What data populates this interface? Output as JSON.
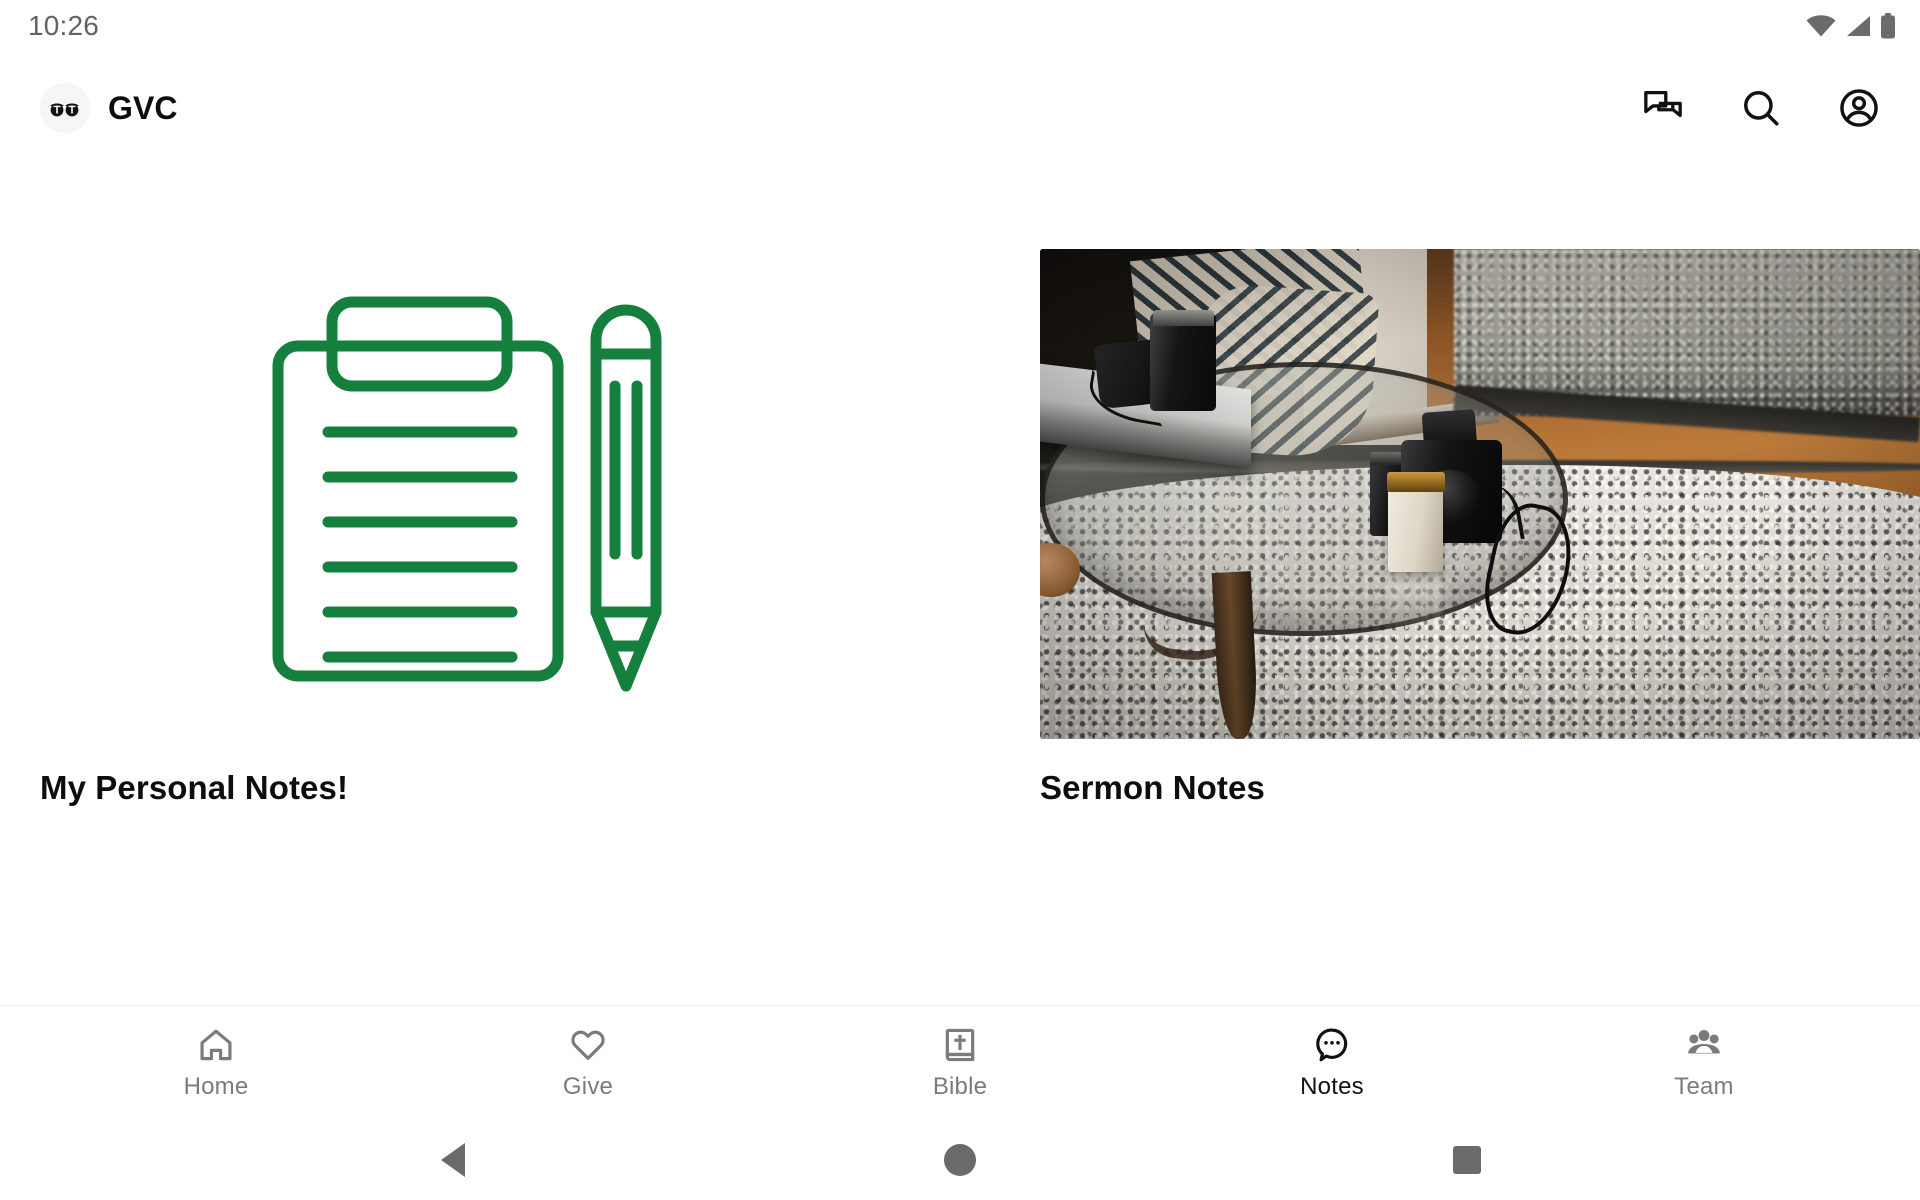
{
  "status_bar": {
    "time": "10:26",
    "icons": [
      "wifi-icon",
      "cellular-signal-icon",
      "battery-icon"
    ],
    "icon_color": "#6b6b6b"
  },
  "header": {
    "logo_icon": "gvc-logo-icon",
    "app_title": "GVC",
    "actions": [
      {
        "name": "messages-icon",
        "label": "Messages"
      },
      {
        "name": "search-icon",
        "label": "Search"
      },
      {
        "name": "account-icon",
        "label": "Account"
      }
    ]
  },
  "main": {
    "cards": [
      {
        "title": "My Personal Notes!",
        "media_type": "illustration",
        "media_icon": "clipboard-pencil-icon",
        "accent_color": "#157f3e",
        "clipboard_lines": 6
      },
      {
        "title": "Sermon Notes",
        "media_type": "photo",
        "media_icon": "coffee-table-cameras-photo"
      }
    ]
  },
  "bottom_nav": {
    "active_index": 3,
    "active_color": "#111111",
    "inactive_color": "#7b7b7b",
    "items": [
      {
        "label": "Home",
        "icon": "home-icon"
      },
      {
        "label": "Give",
        "icon": "heart-icon"
      },
      {
        "label": "Bible",
        "icon": "bible-book-icon"
      },
      {
        "label": "Notes",
        "icon": "notes-bubble-icon"
      },
      {
        "label": "Team",
        "icon": "team-people-icon"
      }
    ]
  },
  "system_nav": {
    "buttons": [
      {
        "name": "android-back-button",
        "icon": "triangle-back-icon"
      },
      {
        "name": "android-home-button",
        "icon": "circle-home-icon"
      },
      {
        "name": "android-recents-button",
        "icon": "square-recents-icon"
      }
    ],
    "color": "#6b6b6b"
  }
}
